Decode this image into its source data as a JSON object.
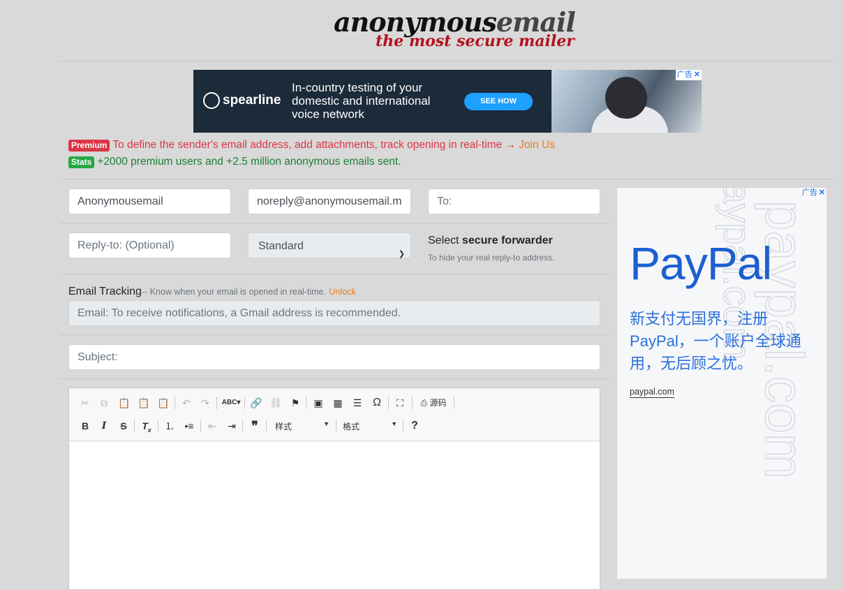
{
  "logo": {
    "name_part1": "anonymous",
    "name_part2": "email",
    "tagline": "the most secure mailer"
  },
  "top_ad": {
    "brand": "spearline",
    "copy": "In-country testing of your domestic and international voice network",
    "cta": "SEE HOW",
    "ad_label": "广告",
    "close": "✕"
  },
  "notices": {
    "premium_badge": "Premium",
    "premium_text": "To define the sender's email address, add attachments, track opening in real-time →",
    "premium_link": "Join Us",
    "stats_badge": "Stats",
    "stats_text": "+2000 premium users and +2.5 million anonymous emails sent."
  },
  "form": {
    "from_name": "Anonymousemail",
    "from_email": "noreply@anonymousemail.me",
    "to_placeholder": "To:",
    "reply_to_placeholder": "Reply-to: (Optional)",
    "forwarder_selected": "Standard",
    "forwarder_label_prefix": "Select ",
    "forwarder_label_bold": "secure forwarder",
    "forwarder_help": "To hide your real reply-to address.",
    "tracking_label": "Email Tracking",
    "tracking_help": "-- Know when your email is opened in real-time.",
    "tracking_unlock": "Unlock",
    "tracking_placeholder": "Email: To receive notifications, a Gmail address is recommended.",
    "subject_placeholder": "Subject:"
  },
  "editor": {
    "source_label": "源码",
    "styles_label": "样式",
    "format_label": "格式",
    "help": "?"
  },
  "right_ad": {
    "watermark": "paypal.com",
    "logo": "PayPal",
    "text": "新支付无国界，注册PayPal，一个账户全球通用，无后顾之忧。",
    "link": "paypal.com",
    "ad_label": "广告",
    "close": "✕"
  },
  "colors": {
    "premium": "#dc3545",
    "stats": "#28a745",
    "link_orange": "#e67e22",
    "paypal_blue": "#1c5fd1"
  }
}
